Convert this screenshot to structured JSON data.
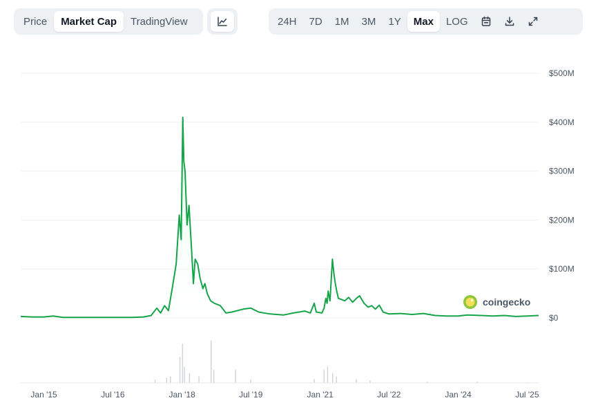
{
  "tabs": [
    {
      "label": "Price",
      "active": false
    },
    {
      "label": "Market Cap",
      "active": true
    },
    {
      "label": "TradingView",
      "active": false
    }
  ],
  "chart_toggle_icon": "line-chart-icon",
  "ranges": [
    {
      "label": "24H",
      "active": false
    },
    {
      "label": "7D",
      "active": false
    },
    {
      "label": "1M",
      "active": false
    },
    {
      "label": "3M",
      "active": false
    },
    {
      "label": "1Y",
      "active": false
    },
    {
      "label": "Max",
      "active": true
    },
    {
      "label": "LOG",
      "active": false
    }
  ],
  "tool_icons": [
    "calendar-icon",
    "download-icon",
    "expand-icon"
  ],
  "watermark": "coingecko",
  "colors": {
    "line": "#16a34a",
    "fill": "#dcfce7",
    "grid": "#eef0f3",
    "volume": "#d1d5db"
  },
  "chart_data": {
    "type": "area",
    "x_ticks": [
      "Jan '15",
      "Jul '16",
      "Jan '18",
      "Jul '19",
      "Jan '21",
      "Jul '22",
      "Jan '24",
      "Jul '25"
    ],
    "y_ticks": [
      "$0",
      "$100M",
      "$200M",
      "$300M",
      "$400M",
      "$500M"
    ],
    "ylim": [
      0,
      500
    ],
    "xlim": [
      "2014-07-01",
      "2025-09-30"
    ],
    "y_unit": "USD millions",
    "grid": true,
    "series": [
      {
        "values": [
          [
            "2014-07-01",
            3
          ],
          [
            "2014-10-01",
            2
          ],
          [
            "2015-01-01",
            2
          ],
          [
            "2015-03-15",
            4
          ],
          [
            "2015-06-01",
            1
          ],
          [
            "2015-10-01",
            1
          ],
          [
            "2016-01-01",
            1
          ],
          [
            "2016-06-01",
            1
          ],
          [
            "2016-12-01",
            1
          ],
          [
            "2017-03-01",
            2
          ],
          [
            "2017-05-01",
            5
          ],
          [
            "2017-06-15",
            20
          ],
          [
            "2017-07-15",
            10
          ],
          [
            "2017-08-15",
            25
          ],
          [
            "2017-09-15",
            15
          ],
          [
            "2017-10-15",
            60
          ],
          [
            "2017-11-15",
            110
          ],
          [
            "2017-12-10",
            210
          ],
          [
            "2017-12-25",
            160
          ],
          [
            "2018-01-07",
            410
          ],
          [
            "2018-01-15",
            320
          ],
          [
            "2018-01-25",
            300
          ],
          [
            "2018-02-10",
            190
          ],
          [
            "2018-02-25",
            230
          ],
          [
            "2018-03-15",
            150
          ],
          [
            "2018-04-01",
            70
          ],
          [
            "2018-04-15",
            120
          ],
          [
            "2018-05-05",
            110
          ],
          [
            "2018-05-25",
            80
          ],
          [
            "2018-06-15",
            60
          ],
          [
            "2018-07-01",
            70
          ],
          [
            "2018-07-20",
            50
          ],
          [
            "2018-08-15",
            35
          ],
          [
            "2018-09-15",
            30
          ],
          [
            "2018-11-01",
            25
          ],
          [
            "2018-12-15",
            10
          ],
          [
            "2019-02-01",
            12
          ],
          [
            "2019-05-01",
            18
          ],
          [
            "2019-07-01",
            20
          ],
          [
            "2019-09-01",
            12
          ],
          [
            "2019-12-01",
            8
          ],
          [
            "2020-03-15",
            6
          ],
          [
            "2020-06-01",
            10
          ],
          [
            "2020-09-01",
            14
          ],
          [
            "2020-10-15",
            10
          ],
          [
            "2020-11-15",
            30
          ],
          [
            "2020-12-01",
            12
          ],
          [
            "2021-01-15",
            10
          ],
          [
            "2021-02-01",
            20
          ],
          [
            "2021-02-15",
            40
          ],
          [
            "2021-02-25",
            30
          ],
          [
            "2021-03-05",
            55
          ],
          [
            "2021-03-20",
            35
          ],
          [
            "2021-04-08",
            120
          ],
          [
            "2021-04-20",
            90
          ],
          [
            "2021-05-01",
            70
          ],
          [
            "2021-05-12",
            55
          ],
          [
            "2021-05-25",
            40
          ],
          [
            "2021-06-15",
            38
          ],
          [
            "2021-07-15",
            35
          ],
          [
            "2021-08-15",
            42
          ],
          [
            "2021-09-15",
            32
          ],
          [
            "2021-10-15",
            40
          ],
          [
            "2021-11-10",
            45
          ],
          [
            "2021-12-15",
            30
          ],
          [
            "2022-01-15",
            22
          ],
          [
            "2022-02-15",
            25
          ],
          [
            "2022-03-15",
            18
          ],
          [
            "2022-04-15",
            26
          ],
          [
            "2022-05-15",
            12
          ],
          [
            "2022-07-01",
            8
          ],
          [
            "2022-10-01",
            9
          ],
          [
            "2023-01-01",
            7
          ],
          [
            "2023-04-01",
            9
          ],
          [
            "2023-07-01",
            5
          ],
          [
            "2023-10-01",
            4
          ],
          [
            "2024-01-01",
            4
          ],
          [
            "2024-03-15",
            6
          ],
          [
            "2024-07-01",
            5
          ],
          [
            "2024-10-01",
            4
          ],
          [
            "2025-01-01",
            5
          ],
          [
            "2025-04-01",
            3
          ],
          [
            "2025-07-01",
            4
          ],
          [
            "2025-09-30",
            5
          ]
        ]
      }
    ],
    "volume_series": [
      [
        "2017-06-01",
        5
      ],
      [
        "2017-09-01",
        8
      ],
      [
        "2017-10-01",
        10
      ],
      [
        "2017-12-15",
        40
      ],
      [
        "2018-01-05",
        60
      ],
      [
        "2018-01-20",
        25
      ],
      [
        "2018-03-01",
        15
      ],
      [
        "2018-05-15",
        10
      ],
      [
        "2018-08-20",
        65
      ],
      [
        "2018-09-10",
        20
      ],
      [
        "2019-03-01",
        20
      ],
      [
        "2019-07-01",
        5
      ],
      [
        "2020-11-15",
        6
      ],
      [
        "2021-02-01",
        20
      ],
      [
        "2021-03-01",
        25
      ],
      [
        "2021-04-10",
        15
      ],
      [
        "2021-05-10",
        10
      ],
      [
        "2021-10-15",
        6
      ],
      [
        "2022-02-01",
        4
      ],
      [
        "2023-05-01",
        2
      ],
      [
        "2024-06-01",
        2
      ],
      [
        "2025-07-01",
        1
      ]
    ]
  }
}
